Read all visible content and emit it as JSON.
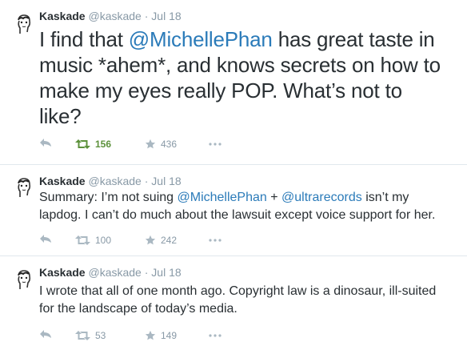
{
  "colors": {
    "text": "#292f33",
    "muted": "#8899a6",
    "link": "#2b7bb9",
    "retweet_active": "#5c913b",
    "divider": "#e1e8ed"
  },
  "tweets": [
    {
      "name": "Kaskade",
      "handle": "@kaskade",
      "separator": "·",
      "date": "Jul 18",
      "lines": [
        {
          "a": "I find that ",
          "mention": "@MichellePhan",
          "b": " has great taste in"
        },
        {
          "a": "music *ahem*, and knows secrets on how to"
        },
        {
          "a": "make my eyes really POP. What’s not to"
        },
        {
          "a": "like?"
        }
      ],
      "retweets": "156",
      "favorites": "436",
      "retweeted": true
    },
    {
      "name": "Kaskade",
      "handle": "@kaskade",
      "separator": "·",
      "date": "Jul 18",
      "lines": [
        {
          "a": "Summary: I’m not suing ",
          "mention": "@MichellePhan",
          "b": " + ",
          "mention2": "@ultrarecords",
          "c": " isn’t my"
        },
        {
          "a": "lapdog. I can’t do much about the lawsuit except voice support for her."
        }
      ],
      "retweets": "100",
      "favorites": "242",
      "retweeted": false
    },
    {
      "name": "Kaskade",
      "handle": "@kaskade",
      "separator": "·",
      "date": "Jul 18",
      "lines": [
        {
          "a": "I wrote that all of one month ago. Copyright law is a dinosaur, ill-suited"
        },
        {
          "a": "for the landscape of today’s media."
        }
      ],
      "retweets": "53",
      "favorites": "149",
      "retweeted": false
    }
  ]
}
